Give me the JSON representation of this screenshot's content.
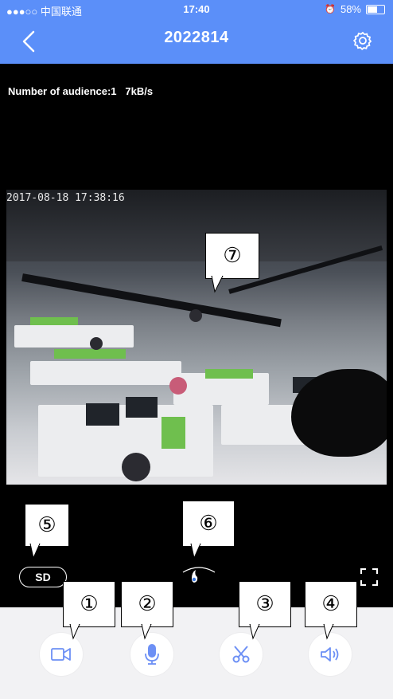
{
  "status_bar": {
    "carrier": "●●●○○ 中国联通",
    "time": "17:40",
    "battery": "58%",
    "battery_level": 0.58
  },
  "nav": {
    "title": "2022814",
    "back_icon": "chevron-left-icon",
    "settings_icon": "gear-icon"
  },
  "video": {
    "audience_text": "Number of audience:1",
    "bitrate": "7kB/s",
    "timestamp": "2017-08-18  17:38:16"
  },
  "controls": {
    "quality_label": "SD",
    "fullscreen_icon": "fullscreen-icon",
    "ptz_icon": "ptz-handle-icon"
  },
  "toolbar": {
    "buttons": [
      {
        "name": "record",
        "icon": "video-camera-icon"
      },
      {
        "name": "talk",
        "icon": "microphone-icon"
      },
      {
        "name": "snapshot",
        "icon": "scissors-icon"
      },
      {
        "name": "sound",
        "icon": "speaker-icon"
      }
    ]
  },
  "callouts": [
    "①",
    "②",
    "③",
    "④",
    "⑤",
    "⑥",
    "⑦"
  ],
  "colors": {
    "header": "#5b8ff9",
    "accent": "#6d90f5",
    "video_bg": "#000000",
    "toolbar_bg": "#f2f2f4"
  }
}
